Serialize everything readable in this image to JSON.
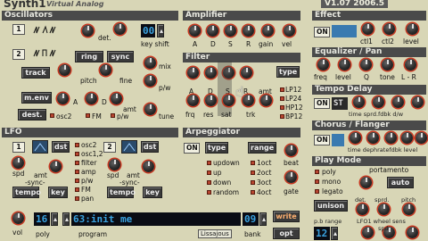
{
  "title": {
    "main": "Synth1",
    "sub": "Virtual Analog",
    "version": "V1.07 2006.5"
  },
  "osc": {
    "header": "Oscillators",
    "n1": "1",
    "n2": "2",
    "det": "det.",
    "keyshift_val": "00",
    "keyshift": "key shift",
    "ring": "ring",
    "sync": "sync",
    "track": "track",
    "pitch": "pitch",
    "fine": "fine",
    "mix": "mix",
    "pw": "p/w",
    "tune": "tune",
    "menv": "m.env",
    "A": "A",
    "D": "D",
    "amt": "amt",
    "dest": "dest.",
    "osc2": "osc2",
    "FM": "FM",
    "pw2": "p/w"
  },
  "amp": {
    "header": "Amplifier",
    "A": "A",
    "D": "D",
    "S": "S",
    "R": "R",
    "gain": "gain",
    "vel": "vel"
  },
  "filter": {
    "header": "Filter",
    "type": "type",
    "frq": "frq",
    "res": "res",
    "sat": "sat",
    "trk": "trk",
    "amt": "amt",
    "A": "A",
    "D": "D",
    "S": "S",
    "R": "R",
    "LP12": "LP12",
    "LP24": "LP24",
    "HP12": "HP12",
    "BP12": "BP12"
  },
  "arp": {
    "header": "Arpeggiator",
    "on": "ON",
    "type": "type",
    "range": "range",
    "updown": "updown",
    "up": "up",
    "down": "down",
    "random": "random",
    "oct1": "1oct",
    "oct2": "2oct",
    "oct3": "3oct",
    "oct4": "4oct",
    "beat": "beat",
    "gate": "gate"
  },
  "effect": {
    "header": "Effect",
    "on": "ON",
    "ctl1": "ctl1",
    "ctl2": "ctl2",
    "level": "level",
    "icon": "fx-type-icon"
  },
  "eq": {
    "header": "Equalizer / Pan",
    "freq": "freq",
    "level": "level",
    "Q": "Q",
    "tone": "tone",
    "LR": "L - R"
  },
  "delay": {
    "header": "Tempo Delay",
    "on": "ON",
    "st": "ST",
    "labels": "time sprd.fdbk d/w"
  },
  "chorus": {
    "header": "Chorus / Flanger",
    "on": "ON",
    "labels": "time dephratefdbk level"
  },
  "play": {
    "header": "Play Mode",
    "poly": "poly",
    "mono": "mono",
    "legato": "legato",
    "portamento": "portamento",
    "auto": "auto",
    "unison": "unison",
    "det": "det.",
    "sprd": "sprd.",
    "pitch": "pitch",
    "pbrange": "p.b range",
    "lfo1wheelsens": "LFO1 wheel sens",
    "val": "12",
    "spd": "spd",
    "amt": "amt",
    "wheel": "wheel"
  },
  "lfo": {
    "header": "LFO",
    "n1": "1",
    "n2": "2",
    "dst": "dst",
    "osc2": "osc2",
    "osc12": "osc1,2",
    "filter": "filter",
    "amp": "amp",
    "pw": "p/w",
    "FM": "FM",
    "pan": "pan",
    "spd": "spd",
    "amt": "amt",
    "sync": "-sync-",
    "tempo": "tempo",
    "key": "key"
  },
  "bottom": {
    "vol": "vol",
    "poly": "poly",
    "poly_val": "16",
    "program": "program",
    "program_val": "63:init me",
    "lissajous": "Lissajous",
    "bank": "bank",
    "bank_val": "09",
    "write": "write",
    "opt": "opt"
  }
}
